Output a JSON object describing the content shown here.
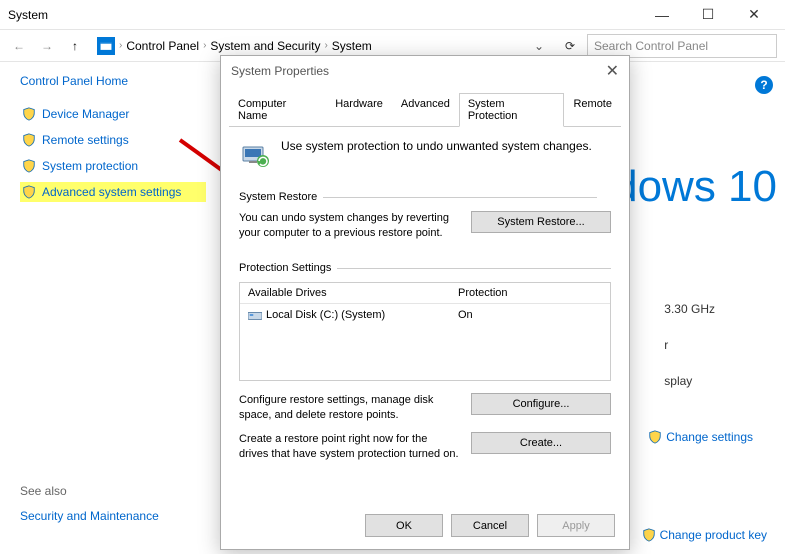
{
  "window": {
    "title": "System"
  },
  "nav": {
    "breadcrumb": [
      "Control Panel",
      "System and Security",
      "System"
    ],
    "search_placeholder": "Search Control Panel"
  },
  "sidebar": {
    "home": "Control Panel Home",
    "links": [
      {
        "label": "Device Manager"
      },
      {
        "label": "Remote settings"
      },
      {
        "label": "System protection"
      },
      {
        "label": "Advanced system settings"
      }
    ],
    "see_also_label": "See also",
    "see_also_link": "Security and Maintenance"
  },
  "content": {
    "brand": "dows 10",
    "cpu_freq": "3.30 GHz",
    "fragment1": "r",
    "fragment2": "splay",
    "change_settings": "Change settings",
    "change_key": "Change product key"
  },
  "dialog": {
    "title": "System Properties",
    "tabs": [
      "Computer Name",
      "Hardware",
      "Advanced",
      "System Protection",
      "Remote"
    ],
    "active_tab": 3,
    "intro": "Use system protection to undo unwanted system changes.",
    "restore": {
      "label": "System Restore",
      "text": "You can undo system changes by reverting your computer to a previous restore point.",
      "button": "System Restore..."
    },
    "protection": {
      "label": "Protection Settings",
      "col_drives": "Available Drives",
      "col_protection": "Protection",
      "rows": [
        {
          "name": "Local Disk (C:) (System)",
          "status": "On"
        }
      ],
      "configure_text": "Configure restore settings, manage disk space, and delete restore points.",
      "configure_button": "Configure...",
      "create_text": "Create a restore point right now for the drives that have system protection turned on.",
      "create_button": "Create..."
    },
    "buttons": {
      "ok": "OK",
      "cancel": "Cancel",
      "apply": "Apply"
    }
  }
}
